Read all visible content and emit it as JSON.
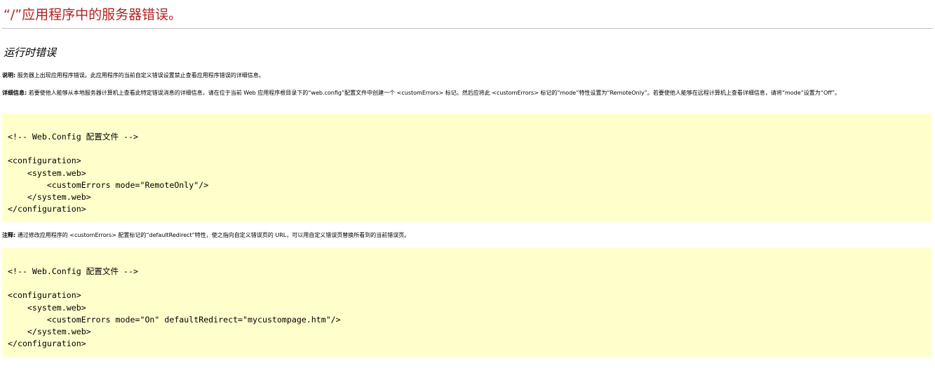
{
  "page": {
    "title": "“/”应用程序中的服务器错误。",
    "subtitle": "运行时错误"
  },
  "description": {
    "label": "说明:",
    "text": " 服务器上出现应用程序错误。此应用程序的当前自定义错误设置禁止查看应用程序错误的详细信息。"
  },
  "details": {
    "label": "详细信息:",
    "text": " 若要使他人能够从本地服务器计算机上查看此特定错误消息的详细信息，请在位于当前 Web 应用程序根目录下的“web.config”配置文件中创建一个 <customErrors> 标记。然后应将此 <customErrors> 标记的“mode”特性设置为“RemoteOnly”。若要使他人能够在远程计算机上查看详细信息，请将“mode”设置为“Off”。"
  },
  "code1": {
    "lines": [
      "<!-- Web.Config 配置文件 -->",
      "",
      "<configuration>",
      "    <system.web>",
      "        <customErrors mode=\"RemoteOnly\"/>",
      "    </system.web>",
      "</configuration>"
    ]
  },
  "note": {
    "label": "注释:",
    "text": " 通过修改应用程序的 <customErrors> 配置标记的“defaultRedirect”特性，使之指向自定义错误页的 URL，可以用自定义错误页替换所看到的当前错误页。"
  },
  "code2": {
    "lines": [
      "<!-- Web.Config 配置文件 -->",
      "",
      "<configuration>",
      "    <system.web>",
      "        <customErrors mode=\"On\" defaultRedirect=\"mycustompage.htm\"/>",
      "    </system.web>",
      "</configuration>"
    ]
  },
  "colors": {
    "title": "#b22222",
    "code_background": "#ffffcc",
    "rule": "#c0c0c0"
  }
}
